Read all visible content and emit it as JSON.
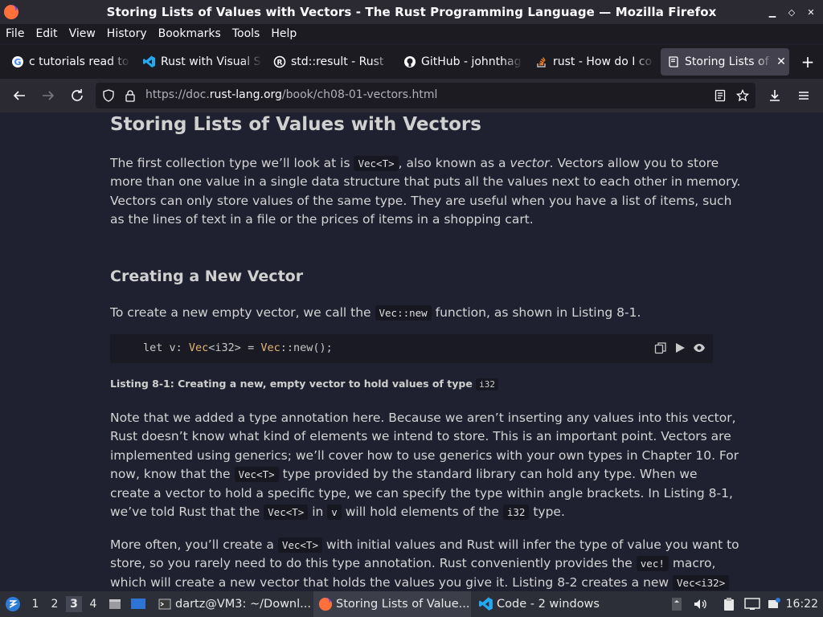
{
  "window": {
    "title": "Storing Lists of Values with Vectors - The Rust Programming Language — Mozilla Firefox",
    "controls": [
      "minimize-icon",
      "restore-icon",
      "close-icon"
    ]
  },
  "menu": [
    "File",
    "Edit",
    "View",
    "History",
    "Bookmarks",
    "Tools",
    "Help"
  ],
  "tabs": [
    {
      "label": "c tutorials read to",
      "icon": "google-icon"
    },
    {
      "label": "Rust with Visual S",
      "icon": "vscode-icon"
    },
    {
      "label": "std::result - Rust",
      "icon": "rust-icon"
    },
    {
      "label": "GitHub - johnthag",
      "icon": "github-icon"
    },
    {
      "label": "rust - How do I co",
      "icon": "stackoverflow-icon"
    },
    {
      "label": "Storing Lists of",
      "icon": "book-icon",
      "active": true
    }
  ],
  "nav": {
    "url_prefix": "https://doc.",
    "url_domain": "rust-lang.org",
    "url_path": "/book/ch08-01-vectors.html"
  },
  "page": {
    "title": "Storing Lists of Values with Vectors",
    "p1": {
      "l1a": "The first collection type we’ll look at is ",
      "l1code": "Vec<T>",
      "l1b": ", also known as a ",
      "l1em": "vector",
      "l1c": ". Vectors allow you to store",
      "l2": "more than one value in a single data structure that puts all the values next to each other in memory.",
      "l3": "Vectors can only store values of the same type. They are useful when you have a list of items, such",
      "l4": "as the lines of text in a file or the prices of items in a shopping cart."
    },
    "section_title": "Creating a New Vector",
    "p2": {
      "a": "To create a new empty vector, we call the ",
      "code": "Vec::new",
      "b": " function, as shown in Listing 8-1."
    },
    "code": {
      "let": "let v: ",
      "ty1": "Vec",
      "gen": "<i32> = ",
      "ty2": "Vec",
      "rest": "::new();"
    },
    "caption": {
      "text": "Listing 8-1: Creating a new, empty vector to hold values of type ",
      "code": "i32"
    },
    "p3": {
      "l1": "Note that we added a type annotation here. Because we aren’t inserting any values into this vector,",
      "l2": "Rust doesn’t know what kind of elements we intend to store. This is an important point. Vectors are",
      "l3": "implemented using generics; we’ll cover how to use generics with your own types in Chapter 10. For",
      "l4a": "now, know that the ",
      "l4code": "Vec<T>",
      "l4b": " type provided by the standard library can hold any type. When we",
      "l5": "create a vector to hold a specific type, we can specify the type within angle brackets. In Listing 8-1,",
      "l6a": "we’ve told Rust that the ",
      "l6code1": "Vec<T>",
      "l6b": " in ",
      "l6code2": "v",
      "l6c": " will hold elements of the ",
      "l6code3": "i32",
      "l6d": " type."
    },
    "p4": {
      "l1a": "More often, you’ll create a ",
      "l1code": "Vec<T>",
      "l1b": " with initial values and Rust will infer the type of value you want to",
      "l2a": "store, so you rarely need to do this type annotation. Rust conveniently provides the ",
      "l2code": "vec!",
      "l2b": " macro,",
      "l3a": "which will create a new vector that holds the values you give it. Listing 8-2 creates a new ",
      "l3code": "Vec<i32>"
    }
  },
  "taskbar": {
    "workspaces": [
      "1",
      "2",
      "3",
      "4"
    ],
    "current_workspace": "3",
    "windows": [
      {
        "label": "dartz@VM3: ~/Downl...",
        "icon": "terminal-icon"
      },
      {
        "label": "Storing Lists of Value...",
        "icon": "firefox-icon",
        "active": true
      },
      {
        "label": "Code - 2 windows",
        "icon": "vscode-icon"
      }
    ],
    "clock": "16:22"
  }
}
